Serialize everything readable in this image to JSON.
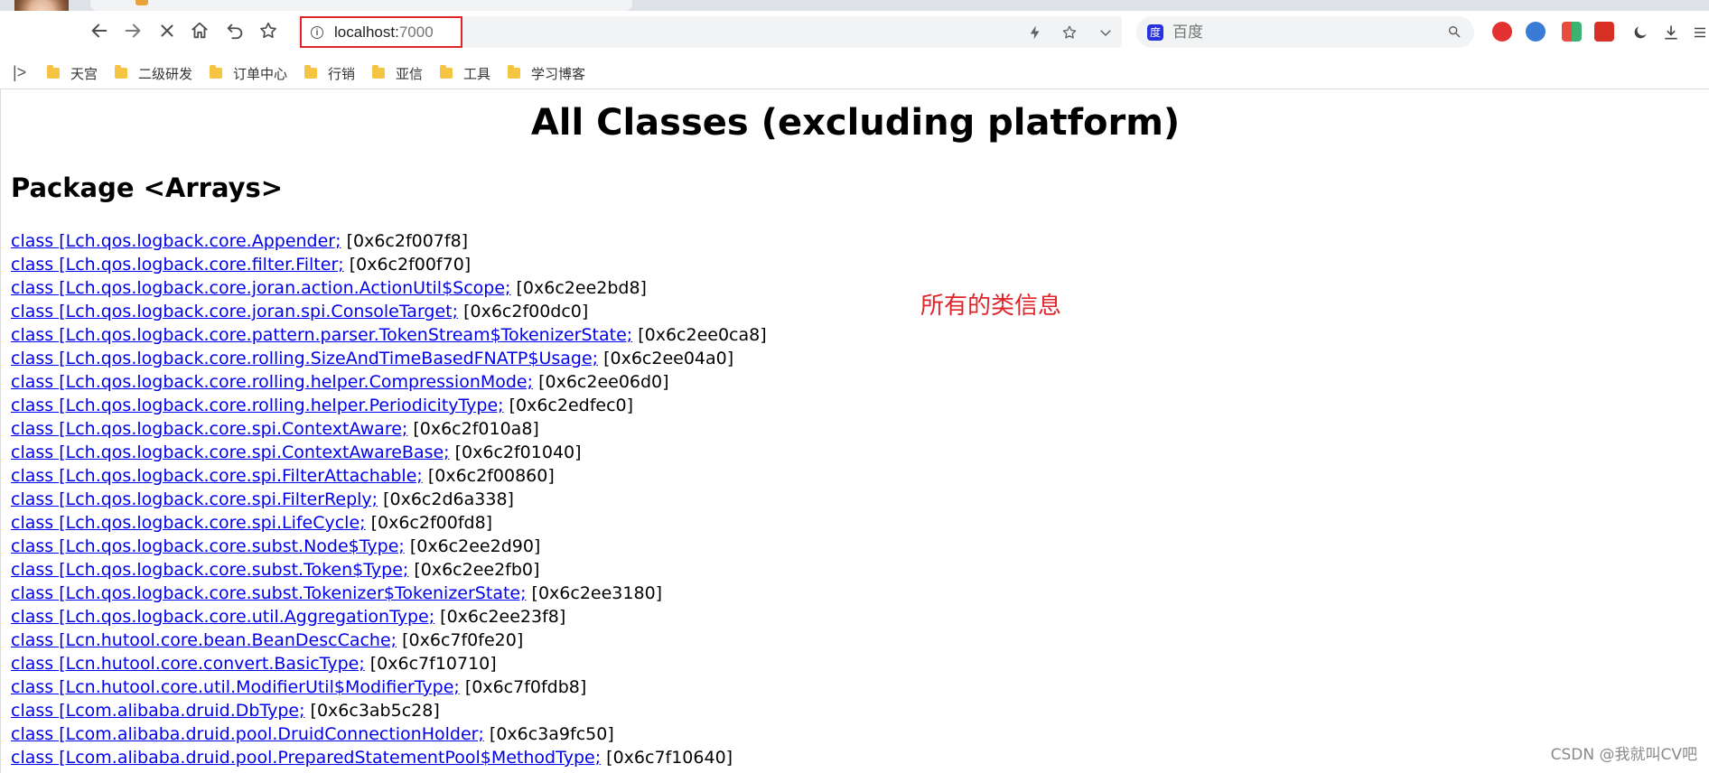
{
  "browser": {
    "url_host": "localhost:",
    "url_port": "7000",
    "search_placeholder": "百度",
    "accent_color": "#e0242a"
  },
  "bookmarks": [
    {
      "label": "天宫"
    },
    {
      "label": "二级研发"
    },
    {
      "label": "订单中心"
    },
    {
      "label": "行销"
    },
    {
      "label": "亚信"
    },
    {
      "label": "工具"
    },
    {
      "label": "学习博客"
    }
  ],
  "page": {
    "title": "All Classes (excluding platform)",
    "package_heading": "Package <Arrays>",
    "classes": [
      {
        "link": "class [Lch.qos.logback.core.Appender;",
        "address": " [0x6c2f007f8]"
      },
      {
        "link": "class [Lch.qos.logback.core.filter.Filter;",
        "address": " [0x6c2f00f70]"
      },
      {
        "link": "class [Lch.qos.logback.core.joran.action.ActionUtil$Scope;",
        "address": " [0x6c2ee2bd8]"
      },
      {
        "link": "class [Lch.qos.logback.core.joran.spi.ConsoleTarget;",
        "address": " [0x6c2f00dc0]"
      },
      {
        "link": "class [Lch.qos.logback.core.pattern.parser.TokenStream$TokenizerState;",
        "address": " [0x6c2ee0ca8]"
      },
      {
        "link": "class [Lch.qos.logback.core.rolling.SizeAndTimeBasedFNATP$Usage;",
        "address": " [0x6c2ee04a0]"
      },
      {
        "link": "class [Lch.qos.logback.core.rolling.helper.CompressionMode;",
        "address": " [0x6c2ee06d0]"
      },
      {
        "link": "class [Lch.qos.logback.core.rolling.helper.PeriodicityType;",
        "address": " [0x6c2edfec0]"
      },
      {
        "link": "class [Lch.qos.logback.core.spi.ContextAware;",
        "address": " [0x6c2f010a8]"
      },
      {
        "link": "class [Lch.qos.logback.core.spi.ContextAwareBase;",
        "address": " [0x6c2f01040]"
      },
      {
        "link": "class [Lch.qos.logback.core.spi.FilterAttachable;",
        "address": " [0x6c2f00860]"
      },
      {
        "link": "class [Lch.qos.logback.core.spi.FilterReply;",
        "address": " [0x6c2d6a338]"
      },
      {
        "link": "class [Lch.qos.logback.core.spi.LifeCycle;",
        "address": " [0x6c2f00fd8]"
      },
      {
        "link": "class [Lch.qos.logback.core.subst.Node$Type;",
        "address": " [0x6c2ee2d90]"
      },
      {
        "link": "class [Lch.qos.logback.core.subst.Token$Type;",
        "address": " [0x6c2ee2fb0]"
      },
      {
        "link": "class [Lch.qos.logback.core.subst.Tokenizer$TokenizerState;",
        "address": " [0x6c2ee3180]"
      },
      {
        "link": "class [Lch.qos.logback.core.util.AggregationType;",
        "address": " [0x6c2ee23f8]"
      },
      {
        "link": "class [Lcn.hutool.core.bean.BeanDescCache;",
        "address": " [0x6c7f0fe20]"
      },
      {
        "link": "class [Lcn.hutool.core.convert.BasicType;",
        "address": " [0x6c7f10710]"
      },
      {
        "link": "class [Lcn.hutool.core.util.ModifierUtil$ModifierType;",
        "address": " [0x6c7f0fdb8]"
      },
      {
        "link": "class [Lcom.alibaba.druid.DbType;",
        "address": " [0x6c3ab5c28]"
      },
      {
        "link": "class [Lcom.alibaba.druid.pool.DruidConnectionHolder;",
        "address": " [0x6c3a9fc50]"
      },
      {
        "link": "class [Lcom.alibaba.druid.pool.PreparedStatementPool$MethodType;",
        "address": " [0x6c7f10640]"
      }
    ]
  },
  "annotation": "所有的类信息",
  "watermark": "CSDN @我就叫CV吧",
  "icons": {
    "back": "back-arrow-icon",
    "forward": "forward-arrow-icon",
    "stop": "stop-icon",
    "home": "home-icon",
    "undo": "undo-icon",
    "bookmark": "star-icon"
  }
}
